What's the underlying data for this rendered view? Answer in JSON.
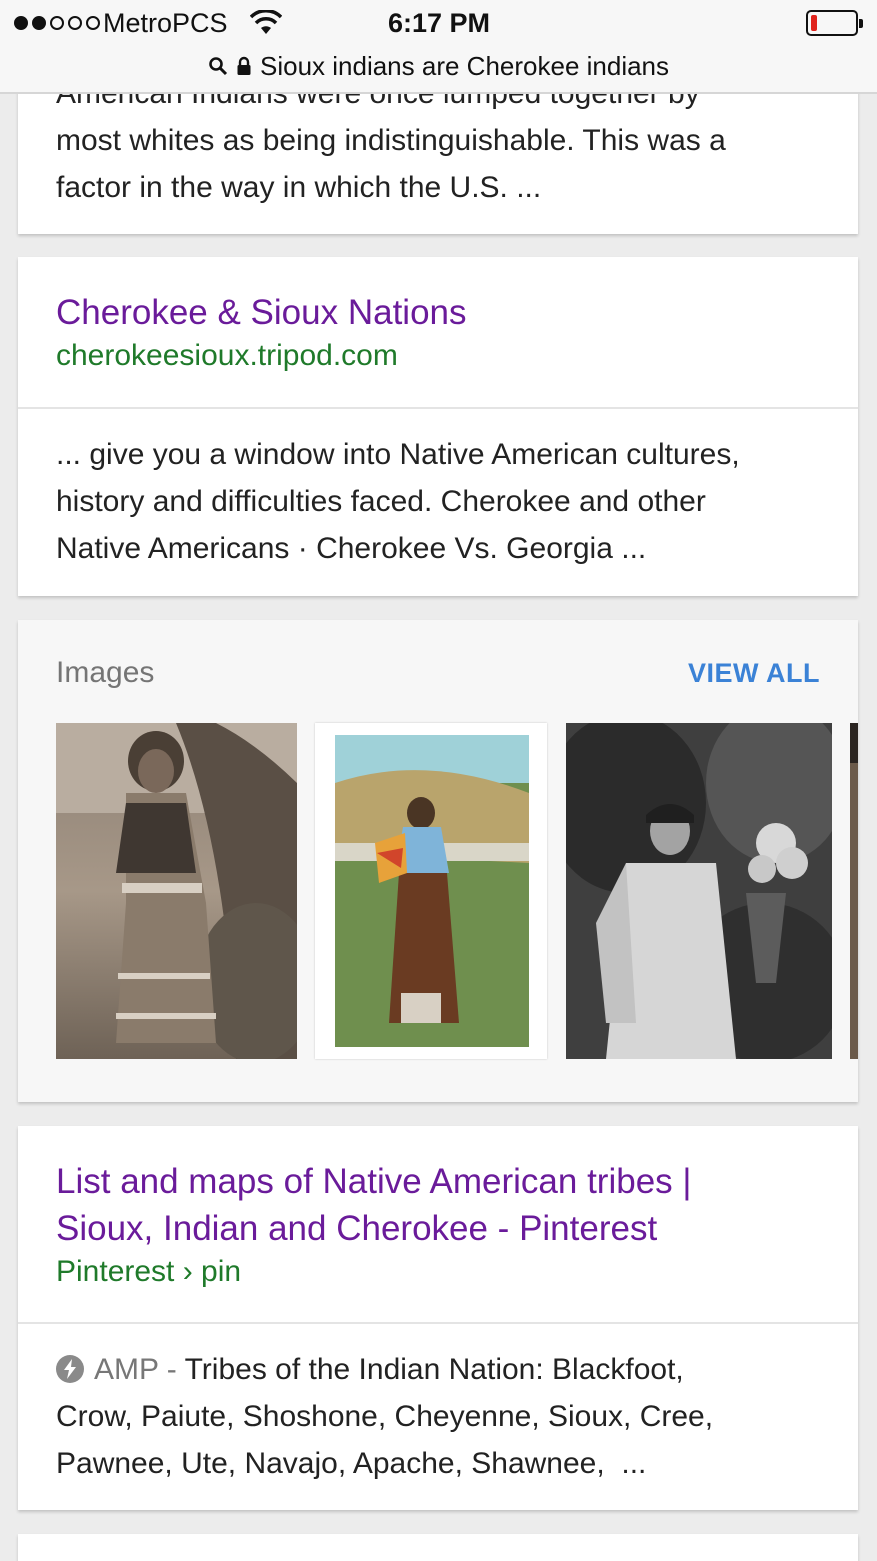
{
  "status_bar": {
    "carrier": "MetroPCS",
    "time": "6:17 PM",
    "signal_bars_filled": 2,
    "signal_bars_total": 5,
    "battery_level": "low"
  },
  "url_bar": {
    "query": "Sioux indians are Cherokee indians"
  },
  "results": [
    {
      "snippet_lines": [
        "American Indians were once lumped together by",
        "most whites as being indistinguishable. This was a",
        "factor in the way in which the U.S. ..."
      ]
    },
    {
      "title": "Cherokee & Sioux Nations",
      "url": "cherokeesioux.tripod.com",
      "snippet_lines": [
        "... give you a window into Native American cultures,",
        "history and difficulties faced. Cherokee and other",
        "Native Americans · Cherokee Vs. Georgia ..."
      ]
    }
  ],
  "images": {
    "label": "Images",
    "view_all": "VIEW ALL"
  },
  "result_pinterest": {
    "title_lines": [
      "List and maps of Native American tribes |",
      "Sioux, Indian and Cherokee - Pinterest"
    ],
    "url": "Pinterest › pin",
    "amp_label": "AMP",
    "amp_sep": " - ",
    "snippet_first": "Tribes of the Indian Nation: Blackfoot,",
    "snippet_lines": [
      "Crow, Paiute, Shoshone, Cheyenne, Sioux, Cree,",
      "Pawnee, Ute, Navajo, Apache, Shawnee,  ..."
    ]
  },
  "colors": {
    "visited_link": "#6a1b9a",
    "url_green": "#1f7a2a",
    "view_all_blue": "#3b82d6",
    "battery_red": "#e0231c"
  }
}
